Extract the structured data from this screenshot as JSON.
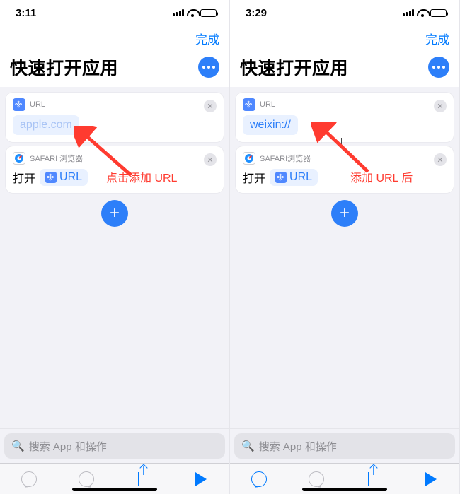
{
  "left": {
    "status_time": "3:11",
    "done_label": "完成",
    "page_title": "快速打开应用",
    "url_card_label": "URL",
    "url_value": "apple.com",
    "safari_card_label": "SAFARI 浏览器",
    "open_label": "打开",
    "open_url_chip": "URL",
    "annotation": "点击添加 URL",
    "search_placeholder": "搜索 App 和操作"
  },
  "right": {
    "status_time": "3:29",
    "done_label": "完成",
    "page_title": "快速打开应用",
    "url_card_label": "URL",
    "url_value": "weixin://",
    "safari_card_label": "SAFARI浏览器",
    "open_label": "打开",
    "open_url_chip": "URL",
    "annotation": "添加 URL 后",
    "search_placeholder": "搜索 App 和操作"
  }
}
